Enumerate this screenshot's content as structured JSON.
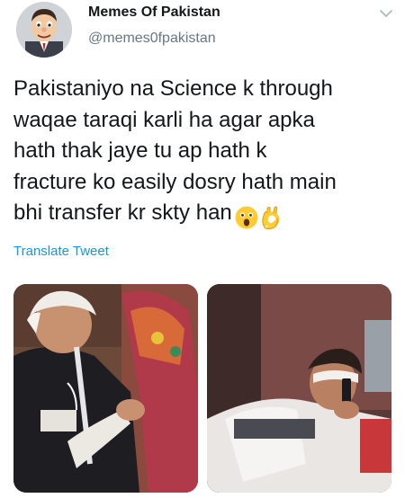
{
  "account": {
    "display_name": "Memes Of Pakistan",
    "handle": "@memes0fpakistan",
    "avatar_icon": "cartoon-face-avatar"
  },
  "tweet": {
    "lines": [
      "Pakistaniyo na Science k through",
      "waqae taraqi karli ha agar apka",
      "hath thak jaye tu ap hath k",
      "fracture ko easily dosry hath main",
      "bhi transfer kr skty han"
    ],
    "emojis": [
      "astonished-face-emoji",
      "ok-hand-emoji"
    ],
    "translate_label": "Translate Tweet"
  },
  "media": [
    {
      "icon": "photo-man-with-bandaged-arm"
    },
    {
      "icon": "photo-man-in-hospital-bed"
    }
  ],
  "colors": {
    "text": "#14171a",
    "secondary": "#657786",
    "link": "#1b95e0"
  }
}
